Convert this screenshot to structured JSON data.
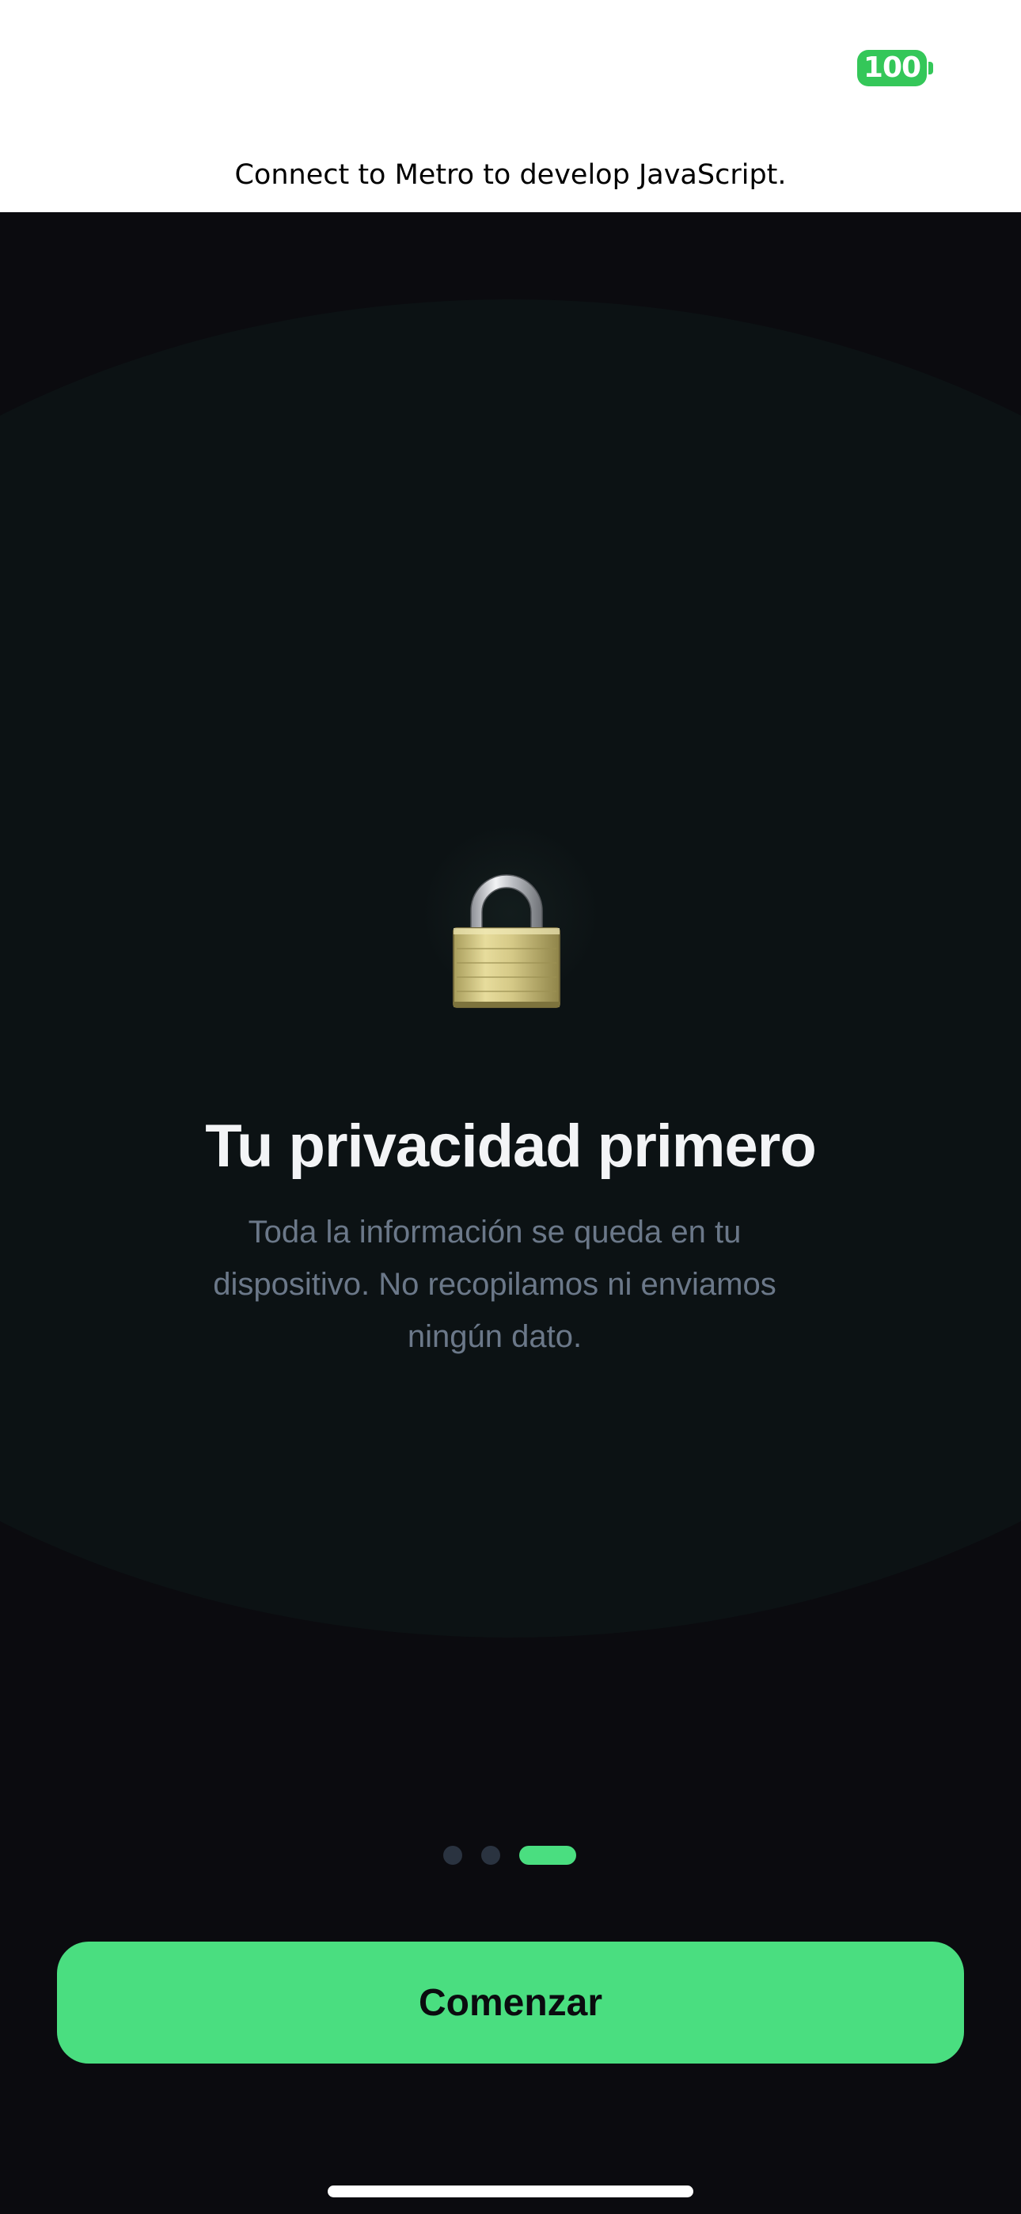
{
  "status_bar": {
    "battery_level": "100",
    "battery_color": "#34c759"
  },
  "dev_banner": {
    "text": "Connect to Metro to develop JavaScript."
  },
  "onboarding": {
    "icon": "lock-icon",
    "title": "Tu privacidad primero",
    "description": "Toda la información se queda en tu dispositivo. No recopilamos ni enviamos ningún dato.",
    "pagination": {
      "total_pages": 3,
      "current_page": 3
    },
    "cta_label": "Comenzar",
    "accent_color": "#4ade80",
    "background_color": "#0b0b0f"
  }
}
